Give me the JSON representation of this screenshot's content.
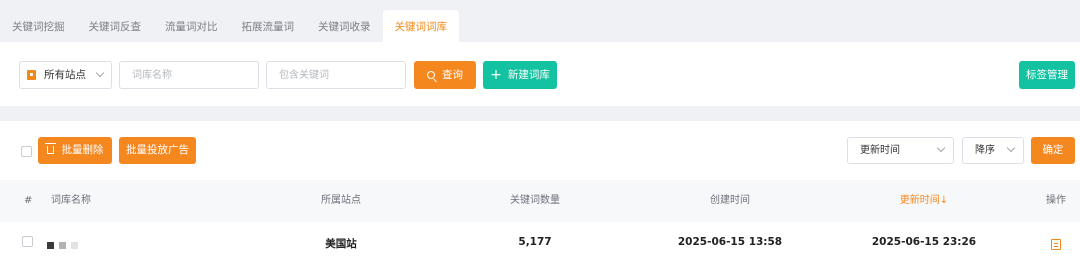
{
  "tabs": [
    "关键词挖掘",
    "关键词反查",
    "流量词对比",
    "拓展流量词",
    "关键词收录",
    "关键词词库"
  ],
  "active_tab_index": 5,
  "filters": {
    "site_select_value": "所有站点",
    "name_placeholder": "词库名称",
    "keyword_placeholder": "包含关键词",
    "search_label": "查询",
    "new_label": "新建词库",
    "tag_manage_label": "标签管理"
  },
  "toolbar": {
    "batch_delete_label": "批量删除",
    "batch_ad_label": "批量投放广告",
    "sort_field_value": "更新时间",
    "sort_order_value": "降序",
    "confirm_label": "确定"
  },
  "table": {
    "headers": {
      "index": "#",
      "name": "词库名称",
      "site": "所属站点",
      "keyword_count": "关键词数量",
      "created": "创建时间",
      "updated": "更新时间↓",
      "ops": "操作"
    },
    "rows": [
      {
        "site": "美国站",
        "keyword_count": "5,177",
        "created": "2025-06-15 13:58",
        "updated": "2025-06-15 23:26"
      }
    ]
  },
  "colors": {
    "accent": "#f5871f",
    "green": "#13c2a0",
    "active_tab": "#f08a17"
  },
  "icons": [
    "flag-icon",
    "chevron-down-icon",
    "search-icon",
    "plus-icon",
    "trash-icon",
    "document-icon"
  ]
}
